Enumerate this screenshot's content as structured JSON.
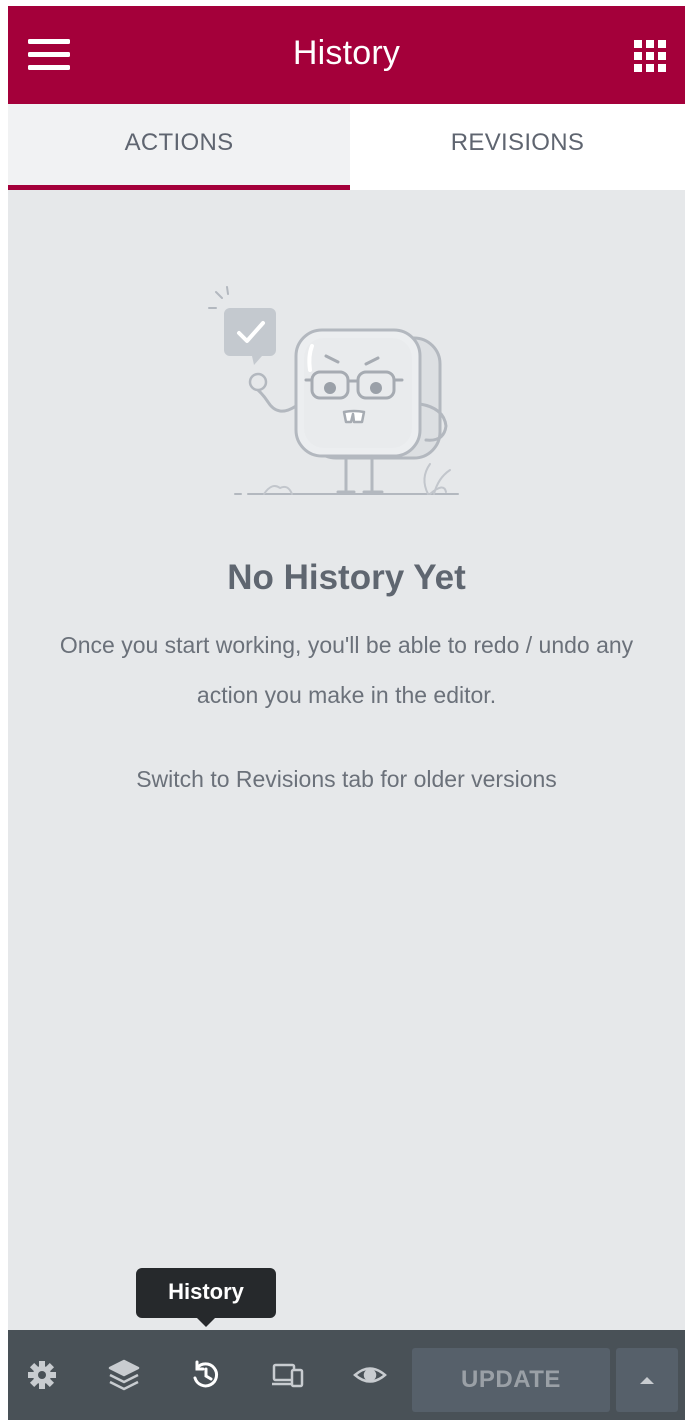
{
  "header": {
    "title": "History",
    "menu_icon": "hamburger-menu-icon",
    "apps_icon": "apps-grid-icon",
    "background_color": "#a4003a"
  },
  "tabs": [
    {
      "label": "ACTIONS",
      "active": true
    },
    {
      "label": "REVISIONS",
      "active": false
    }
  ],
  "empty_state": {
    "illustration": "waving-character-illustration",
    "title": "No History Yet",
    "description": "Once you start working, you'll be able to redo / undo any action you make in the editor.",
    "switch_hint": "Switch to Revisions tab for older versions"
  },
  "tooltip": {
    "text": "History"
  },
  "footer": {
    "icons": [
      "settings-icon",
      "navigator-layers-icon",
      "history-icon",
      "responsive-mode-icon",
      "preview-eye-icon"
    ],
    "update_label": "UPDATE",
    "update_options_icon": "caret-up-icon"
  }
}
